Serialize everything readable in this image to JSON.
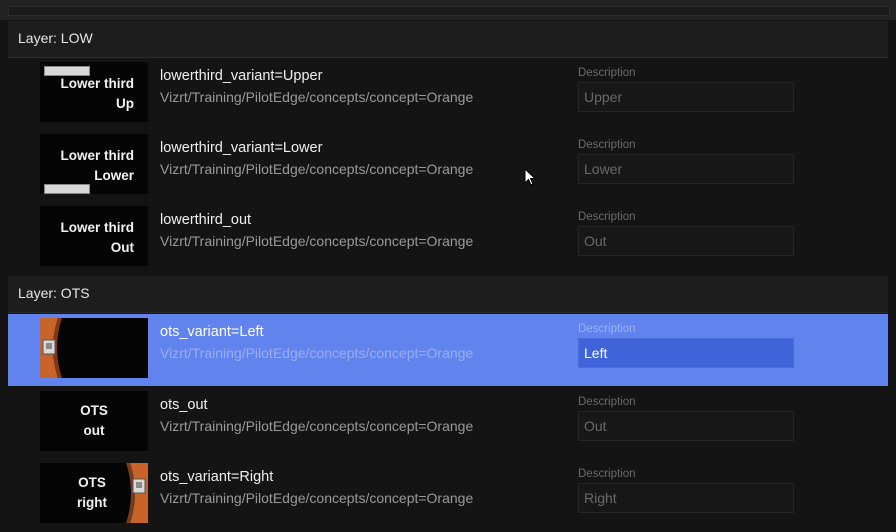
{
  "layers": [
    {
      "header": "Layer: LOW",
      "items": [
        {
          "thumb_lines": [
            "Lower third",
            "Up"
          ],
          "title": "lowerthird_variant=Upper",
          "path": "Vizrt/Training/PilotEdge/concepts/concept=Orange",
          "description_label": "Description",
          "description": "Upper",
          "selected": false
        },
        {
          "thumb_lines": [
            "Lower third",
            "Lower"
          ],
          "title": "lowerthird_variant=Lower",
          "path": "Vizrt/Training/PilotEdge/concepts/concept=Orange",
          "description_label": "Description",
          "description": "Lower",
          "selected": false
        },
        {
          "thumb_lines": [
            "Lower third",
            "Out"
          ],
          "title": "lowerthird_out",
          "path": "Vizrt/Training/PilotEdge/concepts/concept=Orange",
          "description_label": "Description",
          "description": "Out",
          "selected": false
        }
      ]
    },
    {
      "header": "Layer: OTS",
      "items": [
        {
          "thumb_lines": [],
          "title": "ots_variant=Left",
          "path": "Vizrt/Training/PilotEdge/concepts/concept=Orange",
          "description_label": "Description",
          "description": "Left",
          "selected": true
        },
        {
          "thumb_lines": [
            "OTS",
            "out"
          ],
          "title": "ots_out",
          "path": "Vizrt/Training/PilotEdge/concepts/concept=Orange",
          "description_label": "Description",
          "description": "Out",
          "selected": false
        },
        {
          "thumb_lines": [
            "OTS",
            "right"
          ],
          "title": "ots_variant=Right",
          "path": "Vizrt/Training/PilotEdge/concepts/concept=Orange",
          "description_label": "Description",
          "description": "Right",
          "selected": false
        }
      ]
    }
  ],
  "colors": {
    "selection": "#6183ee",
    "accent_orange": "#c8642a",
    "background": "#141414"
  },
  "icons": {
    "pointer": "mouse-pointer-icon"
  }
}
